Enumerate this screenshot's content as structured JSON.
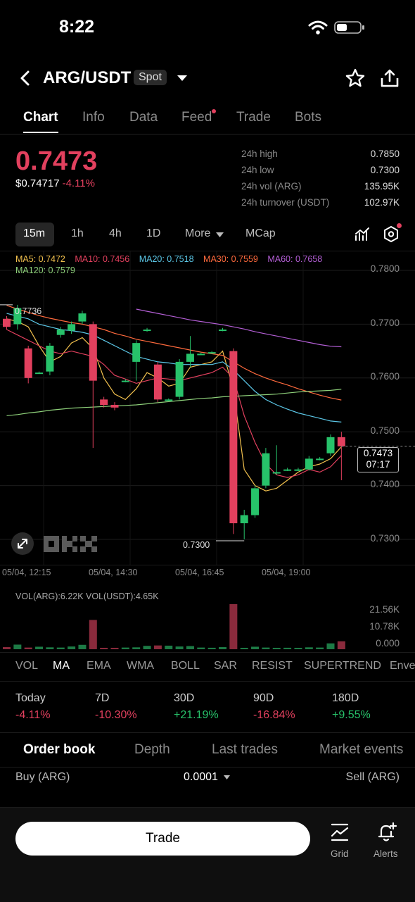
{
  "status_bar": {
    "time": "8:22"
  },
  "header": {
    "pair": "ARG/USDT",
    "badge": "Spot"
  },
  "tabs": [
    {
      "label": "Chart",
      "active": true
    },
    {
      "label": "Info"
    },
    {
      "label": "Data"
    },
    {
      "label": "Feed",
      "dot": true
    },
    {
      "label": "Trade"
    },
    {
      "label": "Bots"
    }
  ],
  "price": {
    "last": "0.7473",
    "usd": "$0.74717",
    "change": "-4.11%"
  },
  "stats": [
    {
      "label": "24h high",
      "value": "0.7850"
    },
    {
      "label": "24h low",
      "value": "0.7300"
    },
    {
      "label": "24h vol (ARG)",
      "value": "135.95K"
    },
    {
      "label": "24h turnover (USDT)",
      "value": "102.97K"
    }
  ],
  "timeframes": [
    "15m",
    "1h",
    "4h",
    "1D",
    "More",
    "MCap"
  ],
  "ma_legend": [
    {
      "label": "MA5: 0.7472",
      "color": "#f2c14e"
    },
    {
      "label": "MA10: 0.7456",
      "color": "#e2405e"
    },
    {
      "label": "MA20: 0.7518",
      "color": "#5cc8e8"
    },
    {
      "label": "MA30: 0.7559",
      "color": "#ff6a3d"
    },
    {
      "label": "MA60: 0.7658",
      "color": "#b45fd6"
    },
    {
      "label": "MA120: 0.7579",
      "color": "#8ed07a"
    }
  ],
  "price_axis": [
    "0.7800",
    "0.7700",
    "0.7600",
    "0.7500",
    "0.7400",
    "0.7300"
  ],
  "annotations": {
    "high": "0.7736",
    "low": "0.7300",
    "current_price": "0.7473",
    "countdown": "07:17"
  },
  "dates": [
    "05/04, 12:15",
    "05/04, 14:30",
    "05/04, 16:45",
    "05/04, 19:00"
  ],
  "volume": {
    "label": "VOL(ARG):6.22K VOL(USDT):4.65K",
    "axis": [
      "21.56K",
      "10.78K",
      "0.000"
    ]
  },
  "indicators": [
    {
      "label": "VOL"
    },
    {
      "label": "MA",
      "active": true
    },
    {
      "label": "EMA"
    },
    {
      "label": "WMA"
    },
    {
      "label": "BOLL"
    },
    {
      "label": "SAR"
    },
    {
      "label": "RESIST"
    },
    {
      "label": "SUPERTREND"
    },
    {
      "label": "Enve"
    }
  ],
  "performance": [
    {
      "label": "Today",
      "value": "-4.11%",
      "dir": "neg"
    },
    {
      "label": "7D",
      "value": "-10.30%",
      "dir": "neg"
    },
    {
      "label": "30D",
      "value": "+21.19%",
      "dir": "pos"
    },
    {
      "label": "90D",
      "value": "-16.84%",
      "dir": "neg"
    },
    {
      "label": "180D",
      "value": "+9.55%",
      "dir": "pos"
    }
  ],
  "orderbook": {
    "tabs": [
      "Order book",
      "Depth",
      "Last trades",
      "Market events"
    ],
    "buy_label": "Buy (ARG)",
    "precision": "0.0001",
    "sell_label": "Sell (ARG)"
  },
  "bottom": {
    "trade": "Trade",
    "grid": "Grid",
    "alerts": "Alerts"
  },
  "chart_data": {
    "type": "candlestick",
    "y_axis_ticks": [
      0.78,
      0.77,
      0.76,
      0.75,
      0.74,
      0.73
    ],
    "candles": [
      {
        "o": 0.771,
        "c": 0.7695,
        "h": 0.7715,
        "l": 0.769
      },
      {
        "o": 0.77,
        "c": 0.773,
        "h": 0.7736,
        "l": 0.769
      },
      {
        "o": 0.7655,
        "c": 0.76,
        "h": 0.766,
        "l": 0.759
      },
      {
        "o": 0.761,
        "c": 0.761,
        "h": 0.7612,
        "l": 0.7608
      },
      {
        "o": 0.7612,
        "c": 0.766,
        "h": 0.7665,
        "l": 0.7605
      },
      {
        "o": 0.768,
        "c": 0.769,
        "h": 0.7695,
        "l": 0.7675
      },
      {
        "o": 0.7688,
        "c": 0.77,
        "h": 0.7705,
        "l": 0.7682
      },
      {
        "o": 0.7705,
        "c": 0.772,
        "h": 0.7725,
        "l": 0.77
      },
      {
        "o": 0.77,
        "c": 0.7595,
        "h": 0.7705,
        "l": 0.747
      },
      {
        "o": 0.756,
        "c": 0.755,
        "h": 0.7565,
        "l": 0.7545
      },
      {
        "o": 0.755,
        "c": 0.7545,
        "h": 0.7555,
        "l": 0.754
      },
      {
        "o": 0.7595,
        "c": 0.7595,
        "h": 0.7598,
        "l": 0.7592
      },
      {
        "o": 0.763,
        "c": 0.7665,
        "h": 0.767,
        "l": 0.7595
      },
      {
        "o": 0.769,
        "c": 0.769,
        "h": 0.7693,
        "l": 0.7686
      },
      {
        "o": 0.7625,
        "c": 0.756,
        "h": 0.763,
        "l": 0.7555
      },
      {
        "o": 0.756,
        "c": 0.756,
        "h": 0.7562,
        "l": 0.7558
      },
      {
        "o": 0.7565,
        "c": 0.763,
        "h": 0.7635,
        "l": 0.756
      },
      {
        "o": 0.763,
        "c": 0.7645,
        "h": 0.7678,
        "l": 0.762
      },
      {
        "o": 0.7645,
        "c": 0.7645,
        "h": 0.7647,
        "l": 0.7643
      },
      {
        "o": 0.7648,
        "c": 0.7648,
        "h": 0.765,
        "l": 0.7645
      },
      {
        "o": 0.769,
        "c": 0.769,
        "h": 0.7693,
        "l": 0.7687
      },
      {
        "o": 0.765,
        "c": 0.733,
        "h": 0.7655,
        "l": 0.731
      },
      {
        "o": 0.733,
        "c": 0.7345,
        "h": 0.7355,
        "l": 0.73
      },
      {
        "o": 0.7345,
        "c": 0.7395,
        "h": 0.74,
        "l": 0.734
      },
      {
        "o": 0.74,
        "c": 0.746,
        "h": 0.747,
        "l": 0.7395
      },
      {
        "o": 0.7425,
        "c": 0.7425,
        "h": 0.7475,
        "l": 0.742
      },
      {
        "o": 0.743,
        "c": 0.743,
        "h": 0.7433,
        "l": 0.7427
      },
      {
        "o": 0.743,
        "c": 0.743,
        "h": 0.7433,
        "l": 0.7427
      },
      {
        "o": 0.743,
        "c": 0.745,
        "h": 0.7455,
        "l": 0.7428
      },
      {
        "o": 0.745,
        "c": 0.745,
        "h": 0.7453,
        "l": 0.7447
      },
      {
        "o": 0.746,
        "c": 0.749,
        "h": 0.7495,
        "l": 0.7455
      },
      {
        "o": 0.749,
        "c": 0.7473,
        "h": 0.75,
        "l": 0.741
      }
    ],
    "ma_series": [
      {
        "name": "MA5",
        "values": [
          0.771,
          0.7705,
          0.7695,
          0.766,
          0.763,
          0.764,
          0.7665,
          0.7675,
          0.7655,
          0.76,
          0.757,
          0.756,
          0.758,
          0.761,
          0.76,
          0.7585,
          0.759,
          0.762,
          0.7625,
          0.763,
          0.765,
          0.758,
          0.743,
          0.74,
          0.739,
          0.7395,
          0.741,
          0.7425,
          0.7435,
          0.744,
          0.745,
          0.7472
        ]
      },
      {
        "name": "MA10",
        "values": [
          0.769,
          0.768,
          0.767,
          0.766,
          0.765,
          0.7645,
          0.765,
          0.7645,
          0.764,
          0.7625,
          0.7605,
          0.7598,
          0.759,
          0.7595,
          0.76,
          0.7598,
          0.7595,
          0.76,
          0.7605,
          0.761,
          0.762,
          0.76,
          0.753,
          0.748,
          0.744,
          0.742,
          0.7415,
          0.742,
          0.743,
          0.7425,
          0.7435,
          0.7456
        ]
      },
      {
        "name": "MA20",
        "values": [
          0.772,
          0.7715,
          0.771,
          0.77,
          0.7695,
          0.769,
          0.7688,
          0.7685,
          0.768,
          0.767,
          0.766,
          0.765,
          0.764,
          0.7635,
          0.763,
          0.7628,
          0.7625,
          0.7625,
          0.7625,
          0.7625,
          0.763,
          0.7615,
          0.7595,
          0.7575,
          0.756,
          0.755,
          0.7542,
          0.7535,
          0.753,
          0.7525,
          0.752,
          0.7518
        ]
      },
      {
        "name": "MA30",
        "values": [
          0.7735,
          0.7728,
          0.7722,
          0.7716,
          0.7711,
          0.7707,
          0.7703,
          0.77,
          0.7695,
          0.769,
          0.7683,
          0.7678,
          0.7672,
          0.7668,
          0.7664,
          0.766,
          0.7656,
          0.7652,
          0.7648,
          0.7645,
          0.7642,
          0.763,
          0.7618,
          0.7608,
          0.76,
          0.7593,
          0.7587,
          0.758,
          0.7574,
          0.7568,
          0.7563,
          0.7559
        ]
      },
      {
        "name": "MA60",
        "values": [
          null,
          null,
          null,
          null,
          null,
          null,
          null,
          null,
          null,
          null,
          null,
          null,
          0.7728,
          0.7724,
          0.772,
          0.7716,
          0.7712,
          0.7708,
          0.7705,
          0.7702,
          0.7699,
          0.7695,
          0.7691,
          0.7686,
          0.7682,
          0.7678,
          0.7674,
          0.767,
          0.7666,
          0.7662,
          0.7659,
          0.7658
        ]
      },
      {
        "name": "MA120",
        "values": [
          0.753,
          0.7532,
          0.7535,
          0.7537,
          0.754,
          0.7542,
          0.7544,
          0.7545,
          0.7546,
          0.7547,
          0.7548,
          0.7549,
          0.755,
          0.7552,
          0.7554,
          0.7556,
          0.7558,
          0.756,
          0.7562,
          0.7563,
          0.7565,
          0.7566,
          0.7567,
          0.7568,
          0.7569,
          0.757,
          0.7572,
          0.7574,
          0.7575,
          0.7576,
          0.7577,
          0.7579
        ]
      }
    ],
    "volume_axis": [
      0,
      10780,
      21560
    ],
    "volume_values": [
      1000,
      2200,
      800,
      1200,
      900,
      800,
      1300,
      2100,
      14000,
      600,
      500,
      800,
      900,
      1600,
      1800,
      1700,
      1300,
      1500,
      800,
      700,
      1000,
      21560,
      500,
      1200,
      800,
      600,
      700,
      600,
      900,
      800,
      2800,
      3800
    ]
  }
}
